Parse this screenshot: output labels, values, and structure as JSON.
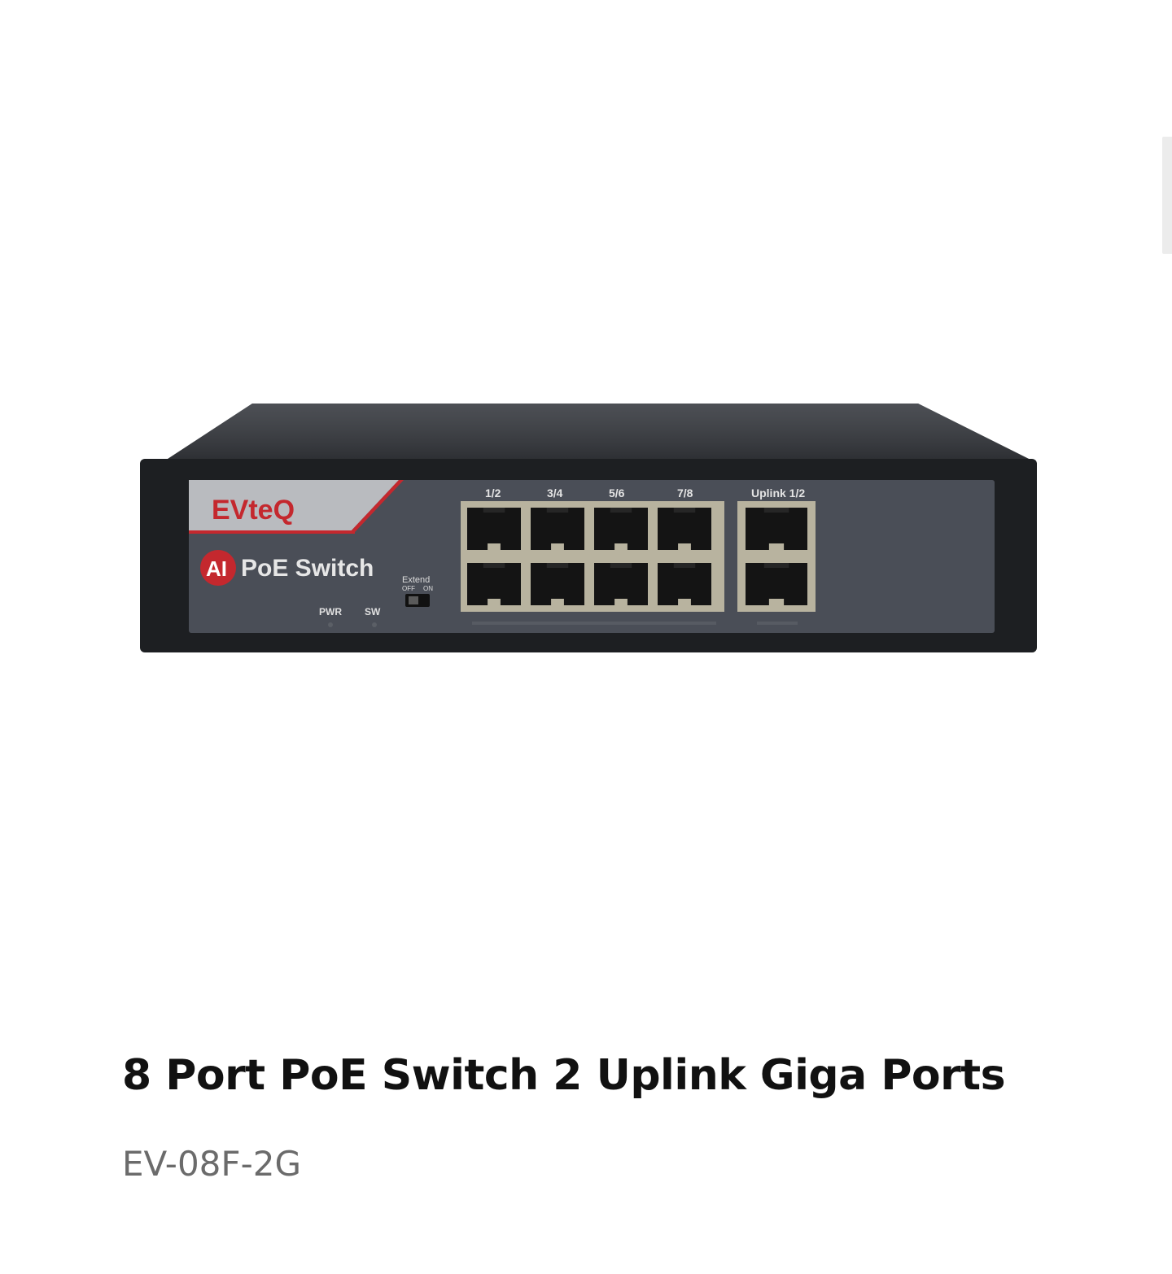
{
  "product": {
    "title": "8 Port PoE Switch 2 Uplink Giga Ports",
    "model": "EV-08F-2G"
  },
  "device": {
    "brand_logo": "EVteQ",
    "badge": "AI",
    "series_label": "PoE Switch",
    "switch_label": "Extend",
    "switch_off": "OFF",
    "switch_on": "ON",
    "led_labels": [
      "PWR",
      "SW"
    ],
    "port_group_labels": [
      "1/2",
      "3/4",
      "5/6",
      "7/8"
    ],
    "uplink_label": "Uplink 1/2",
    "colors": {
      "chassis": "#1d1f22",
      "panel": "#4a4e57",
      "logo_red": "#c4282e",
      "port_frame": "#b8b39f"
    }
  },
  "ui": {
    "scroll_indicator": "scrollbar-thumb"
  }
}
